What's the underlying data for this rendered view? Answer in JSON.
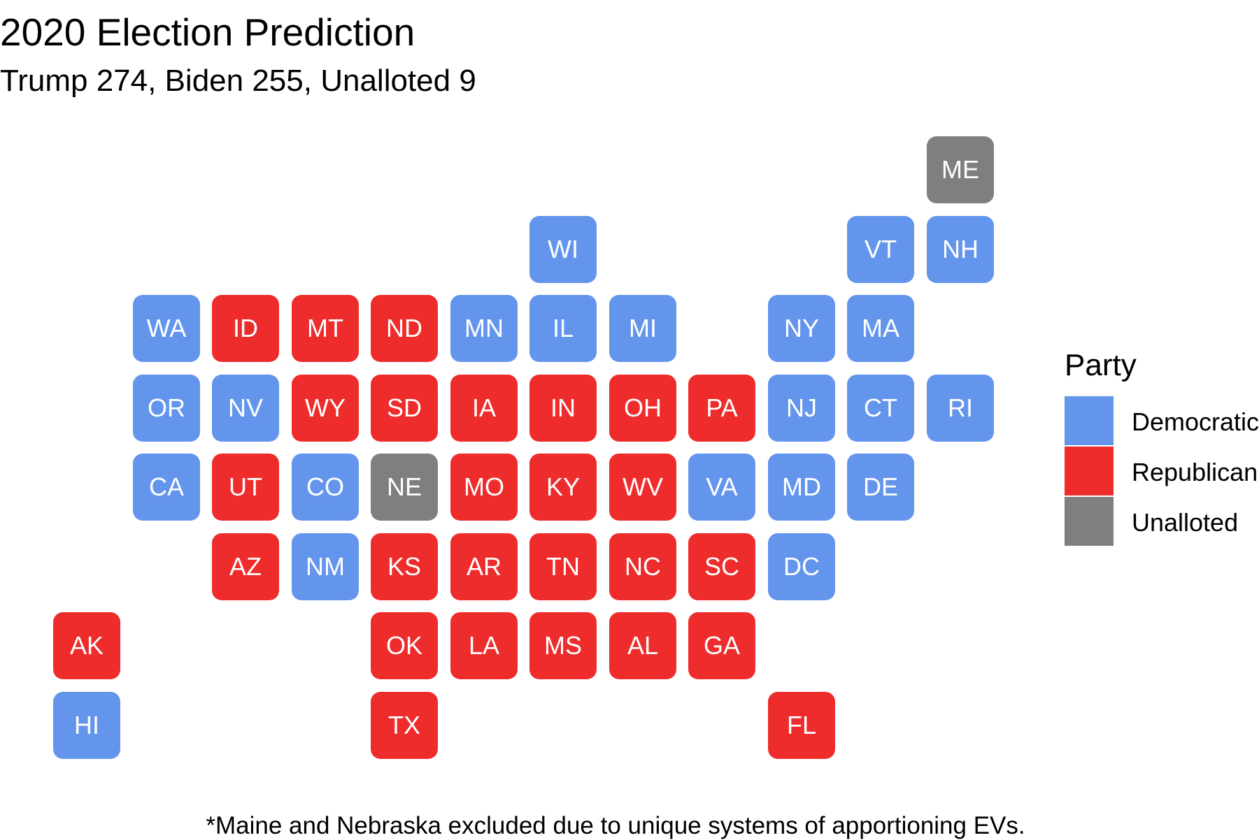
{
  "title": "2020 Election Prediction",
  "subtitle": "Trump 274, Biden 255, Unalloted 9",
  "caption": "*Maine and Nebraska excluded due to unique systems of apportioning EVs.",
  "colors": {
    "Democratic": "#6495ED",
    "Republican": "#EE2C2C",
    "Unalloted": "#7F7F7F"
  },
  "legend": {
    "title": "Party",
    "items": [
      "Democratic",
      "Republican",
      "Unalloted"
    ]
  },
  "states": [
    {
      "abbr": "ME",
      "party": "Unalloted",
      "col": 12,
      "row": 0
    },
    {
      "abbr": "WI",
      "party": "Democratic",
      "col": 7,
      "row": 1
    },
    {
      "abbr": "VT",
      "party": "Democratic",
      "col": 11,
      "row": 1
    },
    {
      "abbr": "NH",
      "party": "Democratic",
      "col": 12,
      "row": 1
    },
    {
      "abbr": "WA",
      "party": "Democratic",
      "col": 2,
      "row": 2
    },
    {
      "abbr": "ID",
      "party": "Republican",
      "col": 3,
      "row": 2
    },
    {
      "abbr": "MT",
      "party": "Republican",
      "col": 4,
      "row": 2
    },
    {
      "abbr": "ND",
      "party": "Republican",
      "col": 5,
      "row": 2
    },
    {
      "abbr": "MN",
      "party": "Democratic",
      "col": 6,
      "row": 2
    },
    {
      "abbr": "IL",
      "party": "Democratic",
      "col": 7,
      "row": 2
    },
    {
      "abbr": "MI",
      "party": "Democratic",
      "col": 8,
      "row": 2
    },
    {
      "abbr": "NY",
      "party": "Democratic",
      "col": 10,
      "row": 2
    },
    {
      "abbr": "MA",
      "party": "Democratic",
      "col": 11,
      "row": 2
    },
    {
      "abbr": "OR",
      "party": "Democratic",
      "col": 2,
      "row": 3
    },
    {
      "abbr": "NV",
      "party": "Democratic",
      "col": 3,
      "row": 3
    },
    {
      "abbr": "WY",
      "party": "Republican",
      "col": 4,
      "row": 3
    },
    {
      "abbr": "SD",
      "party": "Republican",
      "col": 5,
      "row": 3
    },
    {
      "abbr": "IA",
      "party": "Republican",
      "col": 6,
      "row": 3
    },
    {
      "abbr": "IN",
      "party": "Republican",
      "col": 7,
      "row": 3
    },
    {
      "abbr": "OH",
      "party": "Republican",
      "col": 8,
      "row": 3
    },
    {
      "abbr": "PA",
      "party": "Republican",
      "col": 9,
      "row": 3
    },
    {
      "abbr": "NJ",
      "party": "Democratic",
      "col": 10,
      "row": 3
    },
    {
      "abbr": "CT",
      "party": "Democratic",
      "col": 11,
      "row": 3
    },
    {
      "abbr": "RI",
      "party": "Democratic",
      "col": 12,
      "row": 3
    },
    {
      "abbr": "CA",
      "party": "Democratic",
      "col": 2,
      "row": 4
    },
    {
      "abbr": "UT",
      "party": "Republican",
      "col": 3,
      "row": 4
    },
    {
      "abbr": "CO",
      "party": "Democratic",
      "col": 4,
      "row": 4
    },
    {
      "abbr": "NE",
      "party": "Unalloted",
      "col": 5,
      "row": 4
    },
    {
      "abbr": "MO",
      "party": "Republican",
      "col": 6,
      "row": 4
    },
    {
      "abbr": "KY",
      "party": "Republican",
      "col": 7,
      "row": 4
    },
    {
      "abbr": "WV",
      "party": "Republican",
      "col": 8,
      "row": 4
    },
    {
      "abbr": "VA",
      "party": "Democratic",
      "col": 9,
      "row": 4
    },
    {
      "abbr": "MD",
      "party": "Democratic",
      "col": 10,
      "row": 4
    },
    {
      "abbr": "DE",
      "party": "Democratic",
      "col": 11,
      "row": 4
    },
    {
      "abbr": "AZ",
      "party": "Republican",
      "col": 3,
      "row": 5
    },
    {
      "abbr": "NM",
      "party": "Democratic",
      "col": 4,
      "row": 5
    },
    {
      "abbr": "KS",
      "party": "Republican",
      "col": 5,
      "row": 5
    },
    {
      "abbr": "AR",
      "party": "Republican",
      "col": 6,
      "row": 5
    },
    {
      "abbr": "TN",
      "party": "Republican",
      "col": 7,
      "row": 5
    },
    {
      "abbr": "NC",
      "party": "Republican",
      "col": 8,
      "row": 5
    },
    {
      "abbr": "SC",
      "party": "Republican",
      "col": 9,
      "row": 5
    },
    {
      "abbr": "DC",
      "party": "Democratic",
      "col": 10,
      "row": 5
    },
    {
      "abbr": "AK",
      "party": "Republican",
      "col": 1,
      "row": 6
    },
    {
      "abbr": "OK",
      "party": "Republican",
      "col": 5,
      "row": 6
    },
    {
      "abbr": "LA",
      "party": "Republican",
      "col": 6,
      "row": 6
    },
    {
      "abbr": "MS",
      "party": "Republican",
      "col": 7,
      "row": 6
    },
    {
      "abbr": "AL",
      "party": "Republican",
      "col": 8,
      "row": 6
    },
    {
      "abbr": "GA",
      "party": "Republican",
      "col": 9,
      "row": 6
    },
    {
      "abbr": "HI",
      "party": "Democratic",
      "col": 1,
      "row": 7
    },
    {
      "abbr": "TX",
      "party": "Republican",
      "col": 5,
      "row": 7
    },
    {
      "abbr": "FL",
      "party": "Republican",
      "col": 10,
      "row": 7
    }
  ]
}
